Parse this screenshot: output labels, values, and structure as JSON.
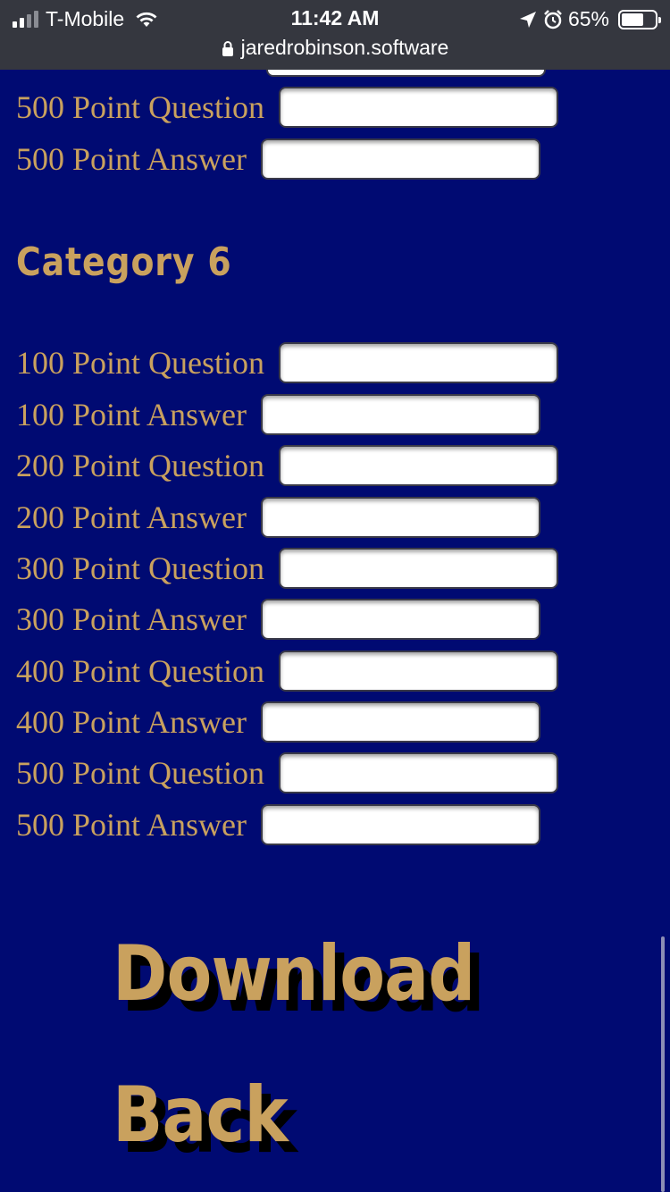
{
  "status_bar": {
    "carrier": "T-Mobile",
    "time": "11:42 AM",
    "battery": "65%",
    "url": "jaredrobinson.software",
    "icons": [
      "signal-icon",
      "wifi-icon",
      "location-icon",
      "alarm-icon",
      "battery-icon",
      "lock-icon"
    ]
  },
  "category5_tail": {
    "q500": "500 Point Question",
    "a500": "500 Point Answer"
  },
  "category6": {
    "title": "Category 6",
    "fields": [
      {
        "label": "100 Point Question",
        "value": ""
      },
      {
        "label": "100 Point Answer",
        "value": ""
      },
      {
        "label": "200 Point Question",
        "value": ""
      },
      {
        "label": "200 Point Answer",
        "value": ""
      },
      {
        "label": "300 Point Question",
        "value": ""
      },
      {
        "label": "300 Point Answer",
        "value": ""
      },
      {
        "label": "400 Point Question",
        "value": ""
      },
      {
        "label": "400 Point Answer",
        "value": ""
      },
      {
        "label": "500 Point Question",
        "value": ""
      },
      {
        "label": "500 Point Answer",
        "value": ""
      }
    ]
  },
  "actions": {
    "download": "Download",
    "back": "Back"
  },
  "colors": {
    "background": "#000a72",
    "label_gold": "#c9a15e",
    "status_bar": "#35373f"
  }
}
